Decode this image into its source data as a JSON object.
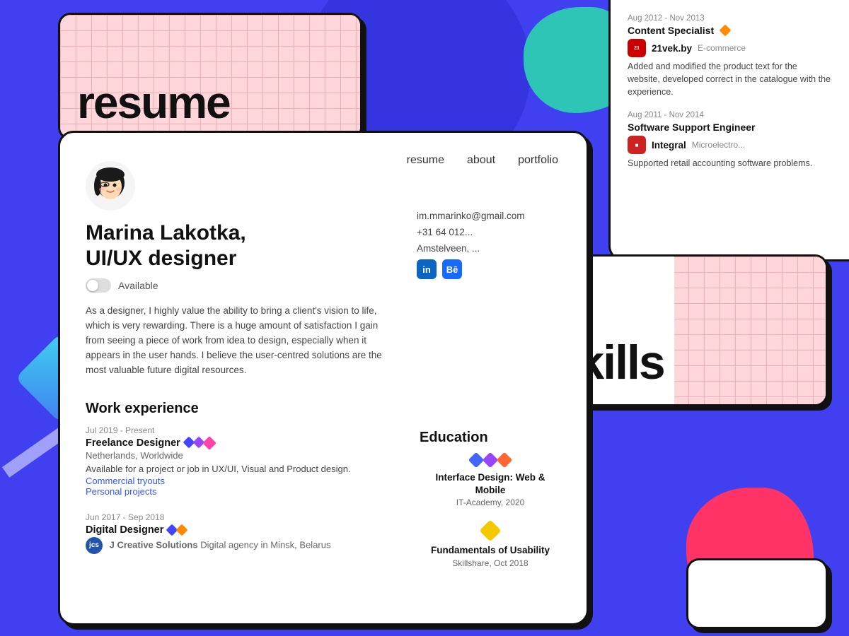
{
  "page": {
    "background_color": "#4040F0"
  },
  "resume_card": {
    "title": "resume"
  },
  "nav": {
    "items": [
      {
        "label": "resume",
        "href": "#"
      },
      {
        "label": "about",
        "href": "#"
      },
      {
        "label": "portfolio",
        "href": "#"
      }
    ]
  },
  "profile": {
    "name": "Marina Lakotka,",
    "title": "UI/UX designer",
    "toggle_label": "Available",
    "bio": "As a designer, I highly value the ability to bring a client's vision to life, which is very rewarding. There is a huge amount of satisfaction I gain from seeing a piece of work from idea to design, especially when it appears in the user hands. I believe the user-centred solutions are the most valuable future digital resources.",
    "email": "im.mmarinko@gmail.com",
    "phone": "+31 64 012...",
    "location": "Amstelveen, ..."
  },
  "work_experience": {
    "section_title": "Work experience",
    "entries": [
      {
        "date": "Jul 2019 - Present",
        "title": "Freelance Designer",
        "location": "Netherlands, Worldwide",
        "description": "Available for a project or job in UX/UI, Visual and Product design.",
        "links": [
          "Commercial tryouts",
          "Personal projects"
        ]
      },
      {
        "date": "Jun 2017 - Sep 2018",
        "title": "Digital Designer",
        "company_abbr": "jcs",
        "company_name": "J Creative Solutions",
        "company_sub": "Digital agency in Minsk, Belarus"
      }
    ]
  },
  "right_panel_experience": {
    "entries": [
      {
        "date": "Aug 2012 - Nov 2013",
        "title": "Content Specialist",
        "company_abbr": "21vek",
        "company_name": "21vek.by",
        "company_sub": "E-commerce",
        "description": "Added and modified the product text for the website, developed correct in the catalogue with the experience."
      },
      {
        "date": "Aug 2011 - Nov 2014",
        "title": "Software Support Engineer",
        "company_abbr": "int",
        "company_name": "Integral",
        "company_sub": "Microelectro...",
        "description": "Supported retail accounting software problems."
      }
    ]
  },
  "education": {
    "section_title": "Education",
    "entries": [
      {
        "title": "Interface Design: Web & Mobile",
        "institution": "IT-Academy, 2020"
      },
      {
        "title": "Fundamentals of Usability",
        "institution": "Skillshare, Oct 2018"
      }
    ]
  },
  "skills_card": {
    "title": "Skills"
  }
}
